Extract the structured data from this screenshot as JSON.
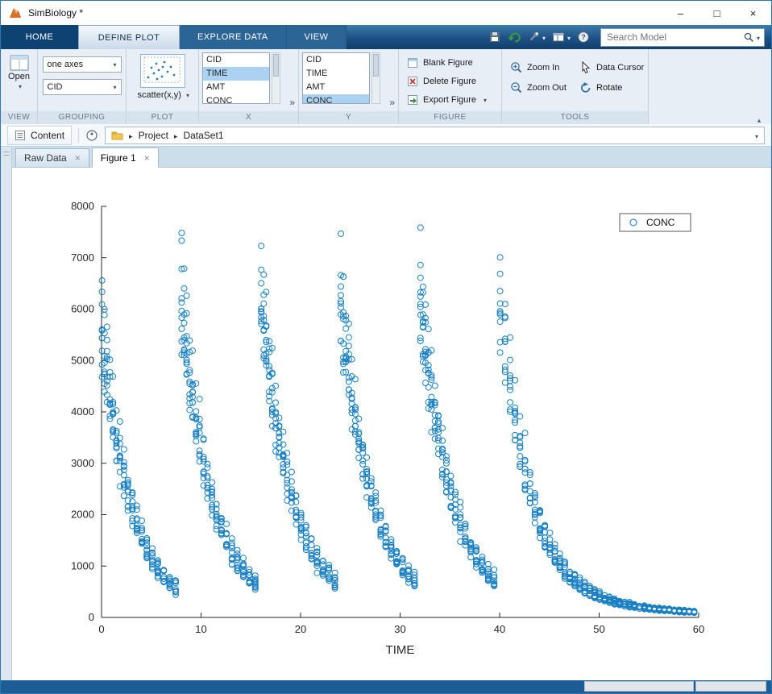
{
  "window": {
    "title": "SimBiology *",
    "controls": {
      "minimize": "–",
      "maximize": "□",
      "close": "×"
    }
  },
  "tab_bar": {
    "tabs": [
      {
        "label": "HOME",
        "active": false
      },
      {
        "label": "DEFINE PLOT",
        "active": true
      },
      {
        "label": "EXPLORE DATA",
        "active": false
      },
      {
        "label": "VIEW",
        "active": false
      }
    ],
    "search": {
      "placeholder": "Search Model"
    }
  },
  "ribbon": {
    "view": {
      "section": "VIEW",
      "open": "Open"
    },
    "grouping": {
      "section": "GROUPING",
      "axes_dropdown": "one axes",
      "group_dropdown": "CID"
    },
    "plot": {
      "section": "PLOT",
      "gallery_label": "scatter(x,y)"
    },
    "x": {
      "section": "X",
      "items": [
        "CID",
        "TIME",
        "AMT",
        "CONC"
      ],
      "selected": "TIME",
      "expand": "»"
    },
    "y": {
      "section": "Y",
      "items": [
        "CID",
        "TIME",
        "AMT",
        "CONC"
      ],
      "selected": "CONC",
      "expand": "»"
    },
    "figure": {
      "section": "FIGURE",
      "blank": "Blank Figure",
      "delete": "Delete Figure",
      "export": "Export Figure"
    },
    "tools": {
      "section": "TOOLS",
      "zoom_in": "Zoom In",
      "zoom_out": "Zoom Out",
      "data_cursor": "Data Cursor",
      "rotate": "Rotate"
    }
  },
  "content_bar": {
    "content": "Content",
    "crumbs": [
      "Project",
      "DataSet1"
    ]
  },
  "doc_tabs": [
    {
      "label": "Raw Data",
      "active": false
    },
    {
      "label": "Figure 1",
      "active": true
    }
  ],
  "chart_data": {
    "type": "scatter",
    "title": "",
    "xlabel": "TIME",
    "ylabel": "",
    "xlim": [
      0,
      60
    ],
    "ylim": [
      0,
      8000
    ],
    "xticks": [
      0,
      10,
      20,
      30,
      40,
      50,
      60
    ],
    "yticks": [
      0,
      1000,
      2000,
      3000,
      4000,
      5000,
      6000,
      7000,
      8000
    ],
    "grid": false,
    "legend": {
      "label": "CONC",
      "position": "northeast"
    },
    "marker": {
      "shape": "circle-open",
      "color": "#0072BD",
      "radius": 3.5
    },
    "series": {
      "name": "CONC",
      "description": "Repeated-dose pharmacokinetic concentrations for multiple subjects: doses at t=0,8,16,24,32,40 with exponential decay, peaks ~4600-7400, troughs ~400-900, terminal decay to ~100 by t=60",
      "generator": {
        "seed": 7,
        "subjects": 10,
        "dose_times": [
          0,
          8,
          16,
          24,
          32,
          40
        ],
        "interval_offsets": [
          0.05,
          0.3,
          0.55,
          0.85,
          1.15,
          1.5,
          1.85,
          2.25,
          2.65,
          3.1,
          3.55,
          4.05,
          4.55,
          5.1,
          5.65,
          6.25,
          6.85,
          7.45
        ],
        "tail_end": 19.95,
        "tail_step": 0.5,
        "amp_mean": 5400,
        "amp_sd": 550,
        "amp_min": 4300,
        "amp_max": 6500,
        "k_min": 0.27,
        "k_max": 0.4,
        "slow_amp": 190,
        "slow_k": 0.07,
        "noise_sd": 0.04
      }
    }
  }
}
